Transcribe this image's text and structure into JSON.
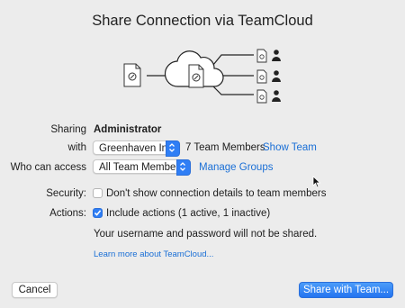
{
  "dialog": {
    "title": "Share Connection via TeamCloud"
  },
  "sharing": {
    "label": "Sharing",
    "value": "Administrator"
  },
  "with": {
    "label": "with",
    "team": "Greenhaven Inc",
    "members": "7 Team Members",
    "show_team_link": "Show Team"
  },
  "access": {
    "label": "Who can access",
    "value": "All Team Members",
    "manage_groups_link": "Manage Groups"
  },
  "security": {
    "label": "Security:",
    "checkbox_label": "Don't show connection details to team members",
    "checked": false
  },
  "actions": {
    "label": "Actions:",
    "checkbox_label": "Include actions (1 active, 1 inactive)",
    "checked": true
  },
  "notice": "Your username and password will not be shared.",
  "learn_more_link": "Learn more about TeamCloud...",
  "buttons": {
    "cancel": "Cancel",
    "share": "Share with Team..."
  },
  "colors": {
    "accent": "#2f7ef5",
    "link": "#1a6fd6",
    "background": "#ececec"
  }
}
